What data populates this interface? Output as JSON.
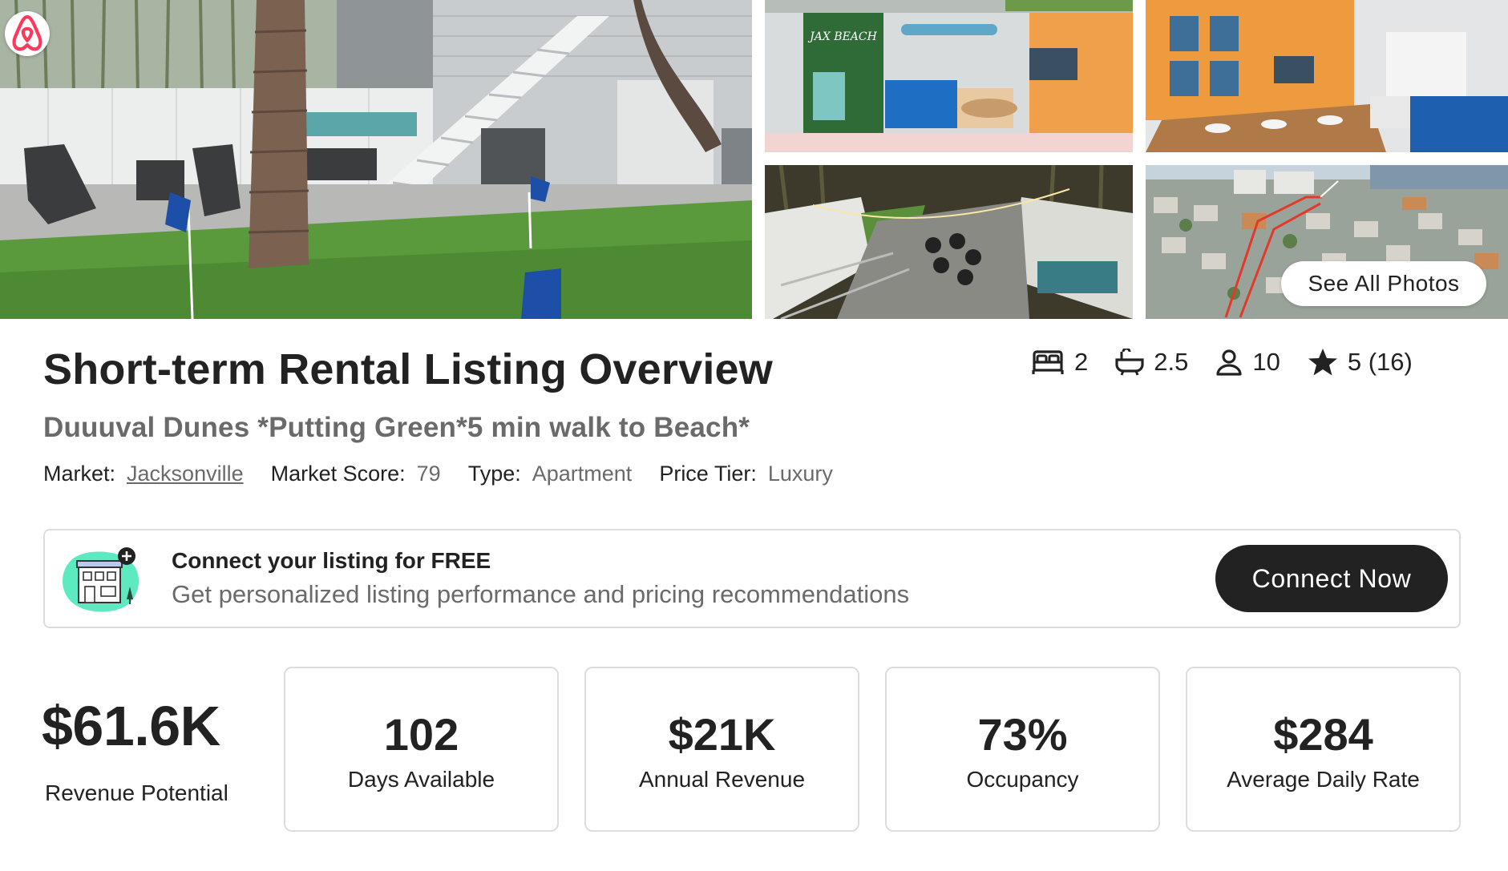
{
  "gallery": {
    "see_all_label": "See All Photos",
    "icon": "airbnb-logo-icon",
    "photos": [
      {
        "subject": "backyard-putting-green"
      },
      {
        "subject": "living-room",
        "sign_text": "JAX BEACH"
      },
      {
        "subject": "dining-room"
      },
      {
        "subject": "rooftop-patio"
      },
      {
        "subject": "aerial-neighborhood"
      }
    ]
  },
  "header": {
    "title": "Short-term Rental Listing Overview",
    "listing_name": "Duuuval Dunes *Putting Green*5 min walk to Beach*"
  },
  "stats": {
    "bedrooms": "2",
    "bathrooms": "2.5",
    "guests": "10",
    "rating": "5 (16)",
    "icons": [
      "bed-icon",
      "bathtub-icon",
      "person-icon",
      "star-icon"
    ]
  },
  "meta": {
    "market_label": "Market:",
    "market_value": "Jacksonville",
    "score_label": "Market Score:",
    "score_value": "79",
    "type_label": "Type:",
    "type_value": "Apartment",
    "tier_label": "Price Tier:",
    "tier_value": "Luxury"
  },
  "connect": {
    "title": "Connect your listing for FREE",
    "subtitle": "Get personalized listing performance and pricing recommendations",
    "button_label": "Connect Now",
    "illustration": "building-plus-icon"
  },
  "metrics": {
    "revenue_potential_value": "$61.6K",
    "revenue_potential_label": "Revenue Potential",
    "cards": [
      {
        "value": "102",
        "label": "Days Available"
      },
      {
        "value": "$21K",
        "label": "Annual Revenue"
      },
      {
        "value": "73%",
        "label": "Occupancy"
      },
      {
        "value": "$284",
        "label": "Average Daily Rate"
      }
    ]
  },
  "colors": {
    "text_primary": "#222222",
    "text_secondary": "#6a6a6a",
    "border": "#dddddd",
    "button_dark": "#222222",
    "airbnb_brand": "#ff385c",
    "illustration_mint": "#5eeac0"
  }
}
